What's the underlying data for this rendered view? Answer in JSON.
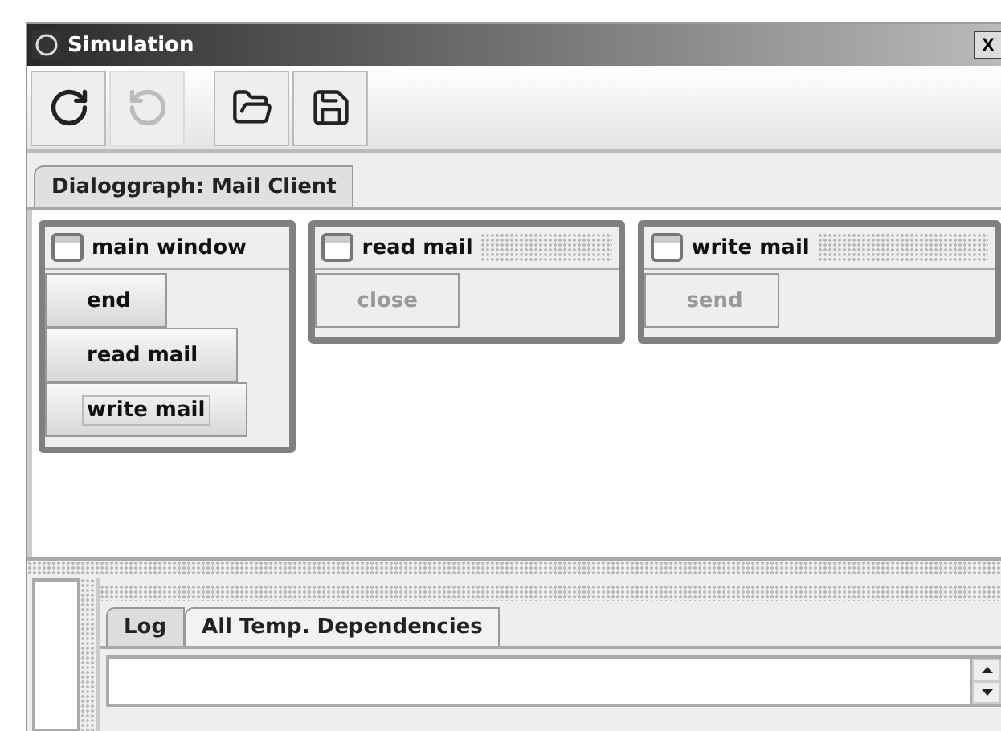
{
  "window": {
    "title": "Simulation",
    "close_label": "X"
  },
  "toolbar": [
    {
      "kind": "undo",
      "disabled": false
    },
    {
      "kind": "redo",
      "disabled": true
    },
    {
      "kind": "open",
      "disabled": false
    },
    {
      "kind": "save",
      "disabled": false
    }
  ],
  "tabs": [
    {
      "label": "Dialoggraph: Mail Client",
      "selected": true
    }
  ],
  "nodes": [
    {
      "title": "main window",
      "active": true,
      "buttons": [
        {
          "label": "end",
          "disabled": false,
          "focused": false
        },
        {
          "label": "read mail",
          "disabled": false,
          "focused": false
        },
        {
          "label": "write mail",
          "disabled": false,
          "focused": true
        }
      ]
    },
    {
      "title": "read mail",
      "active": false,
      "buttons": [
        {
          "label": "close",
          "disabled": true,
          "focused": false
        }
      ]
    },
    {
      "title": "write mail",
      "active": false,
      "buttons": [
        {
          "label": "send",
          "disabled": true,
          "focused": false
        }
      ]
    }
  ],
  "bottom_tabs": [
    {
      "label": "Log",
      "selected": true
    },
    {
      "label": "All Temp. Dependencies",
      "selected": false
    }
  ]
}
